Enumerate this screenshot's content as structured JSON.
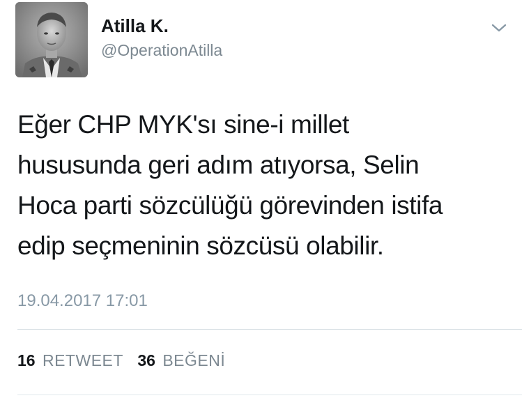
{
  "user": {
    "name": "Atilla K.",
    "handle": "@OperationAtilla"
  },
  "tweet": {
    "text_lines": [
      "Eğer CHP MYK'sı sine-i millet",
      "hususunda geri adım atıyorsa, Selin",
      "Hoca parti sözcülüğü görevinden istifa",
      "edip seçmeninin sözcüsü olabilir."
    ],
    "timestamp": "19.04.2017 17:01"
  },
  "stats": {
    "retweets": {
      "count": "16",
      "label": "RETWEET"
    },
    "likes": {
      "count": "36",
      "label": "BEĞENİ"
    }
  },
  "icons": {
    "menu": "chevron-down-icon",
    "avatar": "profile-photo"
  },
  "colors": {
    "text": "#14171a",
    "secondary": "#7c8891",
    "divider": "#d8dfe4"
  }
}
